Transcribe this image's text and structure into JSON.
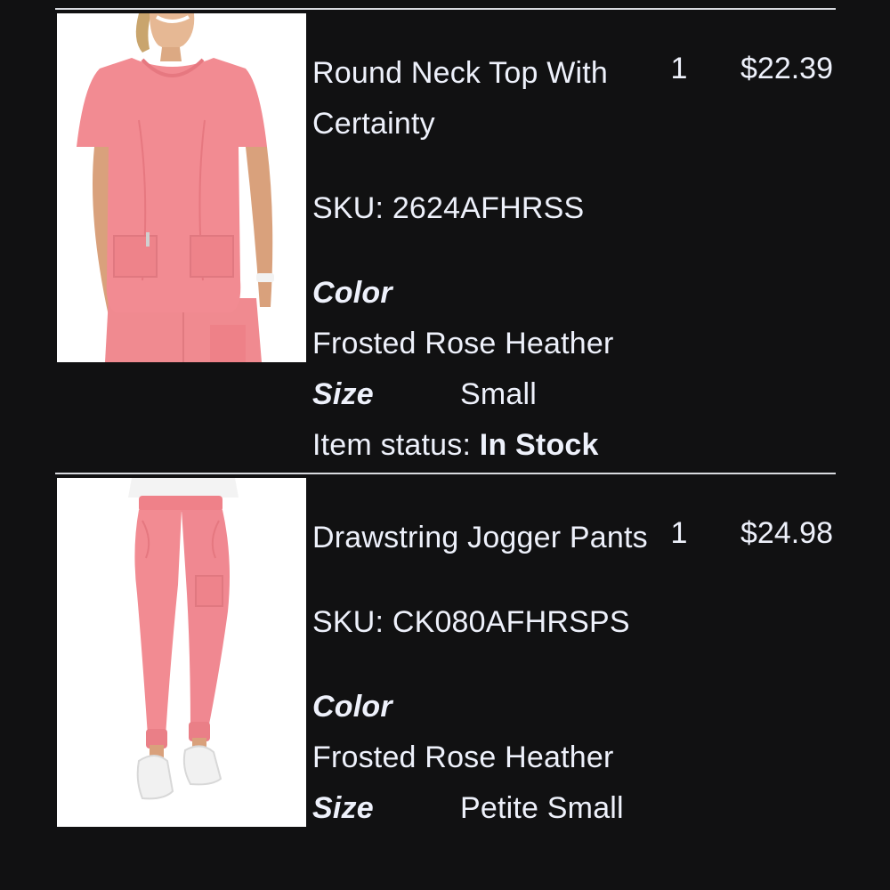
{
  "items": [
    {
      "name": "Round Neck Top With Certainty",
      "quantity": "1",
      "price": "$22.39",
      "sku_label": "SKU:",
      "sku": "2624AFHRSS",
      "color_label": "Color",
      "color": "Frosted Rose Heather",
      "size_label": "Size",
      "size": "Small",
      "status_label": "Item status:",
      "status": "In Stock",
      "image": "pink-scrub-top-photo"
    },
    {
      "name": "Drawstring Jogger Pants",
      "quantity": "1",
      "price": "$24.98",
      "sku_label": "SKU:",
      "sku": "CK080AFHRSPS",
      "color_label": "Color",
      "color": "Frosted Rose Heather",
      "size_label": "Size",
      "size": "Petite Small",
      "image": "pink-jogger-pants-photo"
    }
  ],
  "colors": {
    "background": "#111112",
    "text": "#eef1fb",
    "divider": "#d9dbe0",
    "product_pink": "#f0868d"
  }
}
